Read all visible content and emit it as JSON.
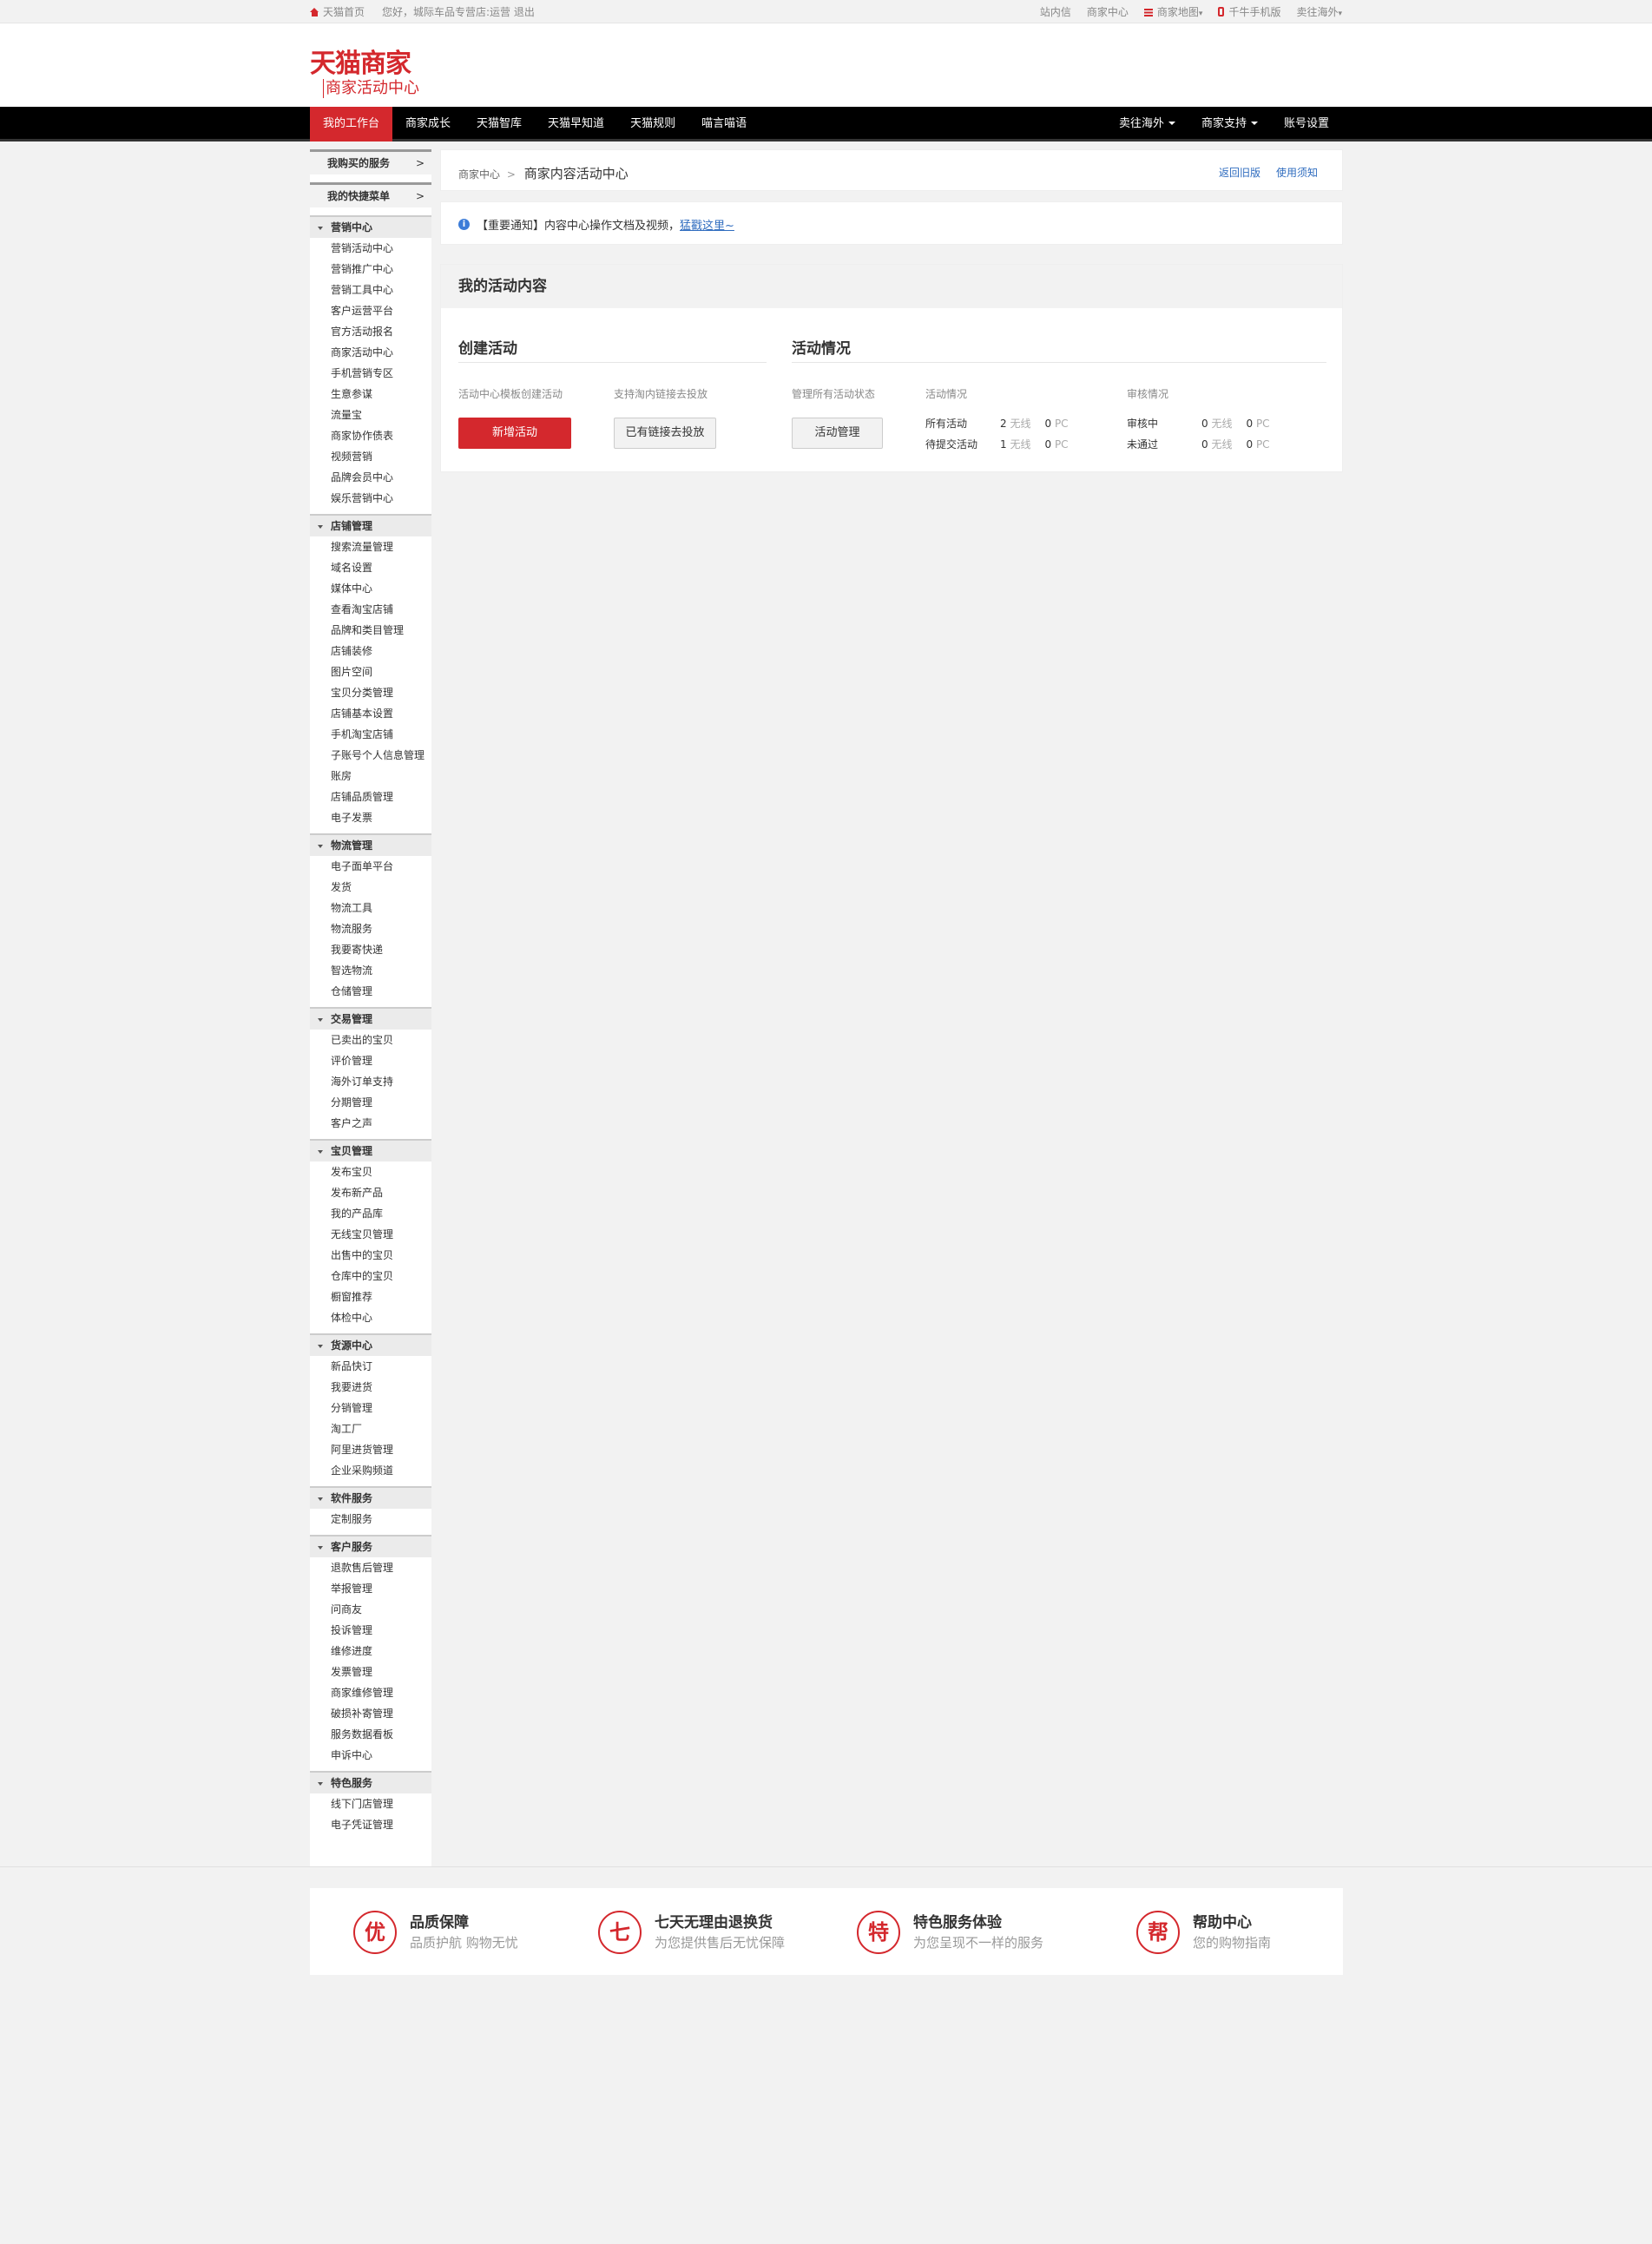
{
  "topbar": {
    "home": "天猫首页",
    "greeting": "您好，城际车品专营店:运营",
    "logout": "退出",
    "links": [
      "站内信",
      "商家中心"
    ],
    "map": "商家地图",
    "mobile": "千牛手机版",
    "overseas": "卖往海外"
  },
  "logo": {
    "line1": "天猫商家",
    "line2": "商家活动中心"
  },
  "nav": {
    "items": [
      "我的工作台",
      "商家成长",
      "天猫智库",
      "天猫早知道",
      "天猫规则",
      "喵言喵语"
    ],
    "right": [
      "卖往海外",
      "商家支持",
      "账号设置"
    ]
  },
  "sidebar": {
    "top": [
      "我购买的服务",
      "我的快捷菜单"
    ],
    "sections": [
      {
        "title": "营销中心",
        "items": [
          "营销活动中心",
          "营销推广中心",
          "营销工具中心",
          "客户运营平台",
          "官方活动报名",
          "商家活动中心",
          "手机营销专区",
          "生意参谋",
          "流量宝",
          "商家协作债表",
          "视频营销",
          "品牌会员中心",
          "娱乐营销中心"
        ]
      },
      {
        "title": "店铺管理",
        "items": [
          "搜索流量管理",
          "域名设置",
          "媒体中心",
          "查看淘宝店铺",
          "品牌和类目管理",
          "店铺装修",
          "图片空间",
          "宝贝分类管理",
          "店铺基本设置",
          "手机淘宝店铺",
          "子账号个人信息管理",
          "账房",
          "店铺品质管理",
          "电子发票"
        ]
      },
      {
        "title": "物流管理",
        "items": [
          "电子面单平台",
          "发货",
          "物流工具",
          "物流服务",
          "我要寄快递",
          "智选物流",
          "仓储管理"
        ]
      },
      {
        "title": "交易管理",
        "items": [
          "已卖出的宝贝",
          "评价管理",
          "海外订单支持",
          "分期管理",
          "客户之声"
        ]
      },
      {
        "title": "宝贝管理",
        "items": [
          "发布宝贝",
          "发布新产品",
          "我的产品库",
          "无线宝贝管理",
          "出售中的宝贝",
          "仓库中的宝贝",
          "橱窗推荐",
          "体检中心"
        ]
      },
      {
        "title": "货源中心",
        "items": [
          "新品快订",
          "我要进货",
          "分销管理",
          "淘工厂",
          "阿里进货管理",
          "企业采购频道"
        ]
      },
      {
        "title": "软件服务",
        "items": [
          "定制服务"
        ]
      },
      {
        "title": "客户服务",
        "items": [
          "退款售后管理",
          "举报管理",
          "问商友",
          "投诉管理",
          "维修进度",
          "发票管理",
          "商家维修管理",
          "破损补寄管理",
          "服务数据看板",
          "申诉中心"
        ]
      },
      {
        "title": "特色服务",
        "items": [
          "线下门店管理",
          "电子凭证管理"
        ]
      }
    ]
  },
  "breadcrumb": {
    "root": "商家中心",
    "sep": ">",
    "current": "商家内容活动中心",
    "links": [
      "返回旧版",
      "使用须知"
    ]
  },
  "notice": {
    "text": "【重要通知】内容中心操作文档及视频，",
    "link": "猛戳这里~"
  },
  "panel": {
    "title": "我的活动内容",
    "create": {
      "title": "创建活动",
      "label1": "活动中心模板创建活动",
      "label2": "支持淘内链接去投放",
      "btn_new": "新增活动",
      "btn_link": "已有链接去投放"
    },
    "status": {
      "title": "活动情况",
      "manage_label": "管理所有活动状态",
      "btn_manage": "活动管理",
      "activity_header": "活动情况",
      "review_header": "审核情况",
      "rows": [
        {
          "name": "所有活动",
          "wireless": "2",
          "pc": "0"
        },
        {
          "name": "待提交活动",
          "wireless": "1",
          "pc": "0"
        }
      ],
      "review_rows": [
        {
          "name": "审核中",
          "wireless": "0",
          "pc": "0"
        },
        {
          "name": "未通过",
          "wireless": "0",
          "pc": "0"
        }
      ],
      "unit_wireless": "无线",
      "unit_pc": "PC"
    }
  },
  "footer": [
    {
      "icon": "优",
      "title": "品质保障",
      "sub": "品质护航 购物无忧"
    },
    {
      "icon": "七",
      "title": "七天无理由退换货",
      "sub": "为您提供售后无忧保障"
    },
    {
      "icon": "特",
      "title": "特色服务体验",
      "sub": "为您呈现不一样的服务"
    },
    {
      "icon": "帮",
      "title": "帮助中心",
      "sub": "您的购物指南"
    }
  ]
}
